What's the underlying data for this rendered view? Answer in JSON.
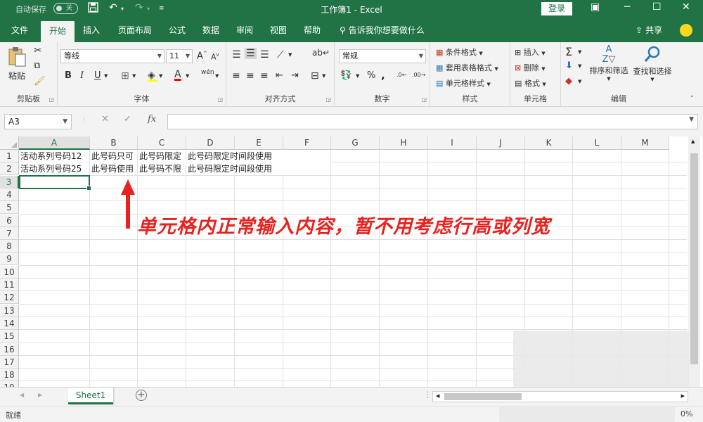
{
  "titlebar": {
    "autosave_label": "自动保存",
    "autosave_state": "关",
    "title": "工作簿1  -  Excel",
    "login_label": "登录"
  },
  "tabs": [
    {
      "label": "文件",
      "active": false
    },
    {
      "label": "开始",
      "active": true
    },
    {
      "label": "插入",
      "active": false
    },
    {
      "label": "页面布局",
      "active": false
    },
    {
      "label": "公式",
      "active": false
    },
    {
      "label": "数据",
      "active": false
    },
    {
      "label": "审阅",
      "active": false
    },
    {
      "label": "视图",
      "active": false
    },
    {
      "label": "帮助",
      "active": false
    }
  ],
  "tell_me": "告诉我你想要做什么",
  "share_label": "共享",
  "ribbon": {
    "clipboard": {
      "label": "剪贴板",
      "paste": "粘贴"
    },
    "font": {
      "label": "字体",
      "font_name": "等线",
      "font_size": "11",
      "bold": "B",
      "italic": "I",
      "underline": "U",
      "font_color_glyph": "A",
      "phonetic": "wén"
    },
    "alignment": {
      "label": "对齐方式"
    },
    "number": {
      "label": "数字",
      "format": "常规",
      "percent": "%",
      "comma": ","
    },
    "styles": {
      "label": "样式",
      "conditional": "条件格式",
      "table": "套用表格格式",
      "cell_styles": "单元格样式"
    },
    "cells": {
      "label": "单元格",
      "insert": "插入",
      "delete": "删除",
      "format": "格式"
    },
    "editing": {
      "label": "编辑",
      "sort_filter": "排序和筛选",
      "find_select": "查找和选择"
    }
  },
  "formula_bar": {
    "name_box": "A3",
    "fx": "fx",
    "content": ""
  },
  "columns": [
    "A",
    "B",
    "C",
    "D",
    "E",
    "F",
    "G",
    "H",
    "I",
    "J",
    "K",
    "L",
    "M"
  ],
  "rows": [
    "1",
    "2",
    "3",
    "4",
    "5",
    "6",
    "7",
    "8",
    "9",
    "10",
    "11",
    "12",
    "13",
    "14",
    "15",
    "16",
    "17",
    "18",
    "19"
  ],
  "cells": {
    "A1": "活动系列号码12",
    "B1": "此号码只可",
    "C1": "此号码限定",
    "D1": "此号码限定时间段使用",
    "A2": "活动系列号码25",
    "B2": "此号码使用",
    "C2": "此号码不限",
    "D2": "此号码限定时间段使用"
  },
  "active_cell": "A3",
  "annotation": "单元格内正常输入内容，暂不用考虑行高或列宽",
  "sheets": [
    {
      "name": "Sheet1",
      "active": true
    }
  ],
  "status": {
    "ready": "就绪",
    "zoom": "0%"
  },
  "colors": {
    "brand": "#217346",
    "annotation": "#e8221e",
    "ribbon_bg": "#f3f3f3"
  }
}
